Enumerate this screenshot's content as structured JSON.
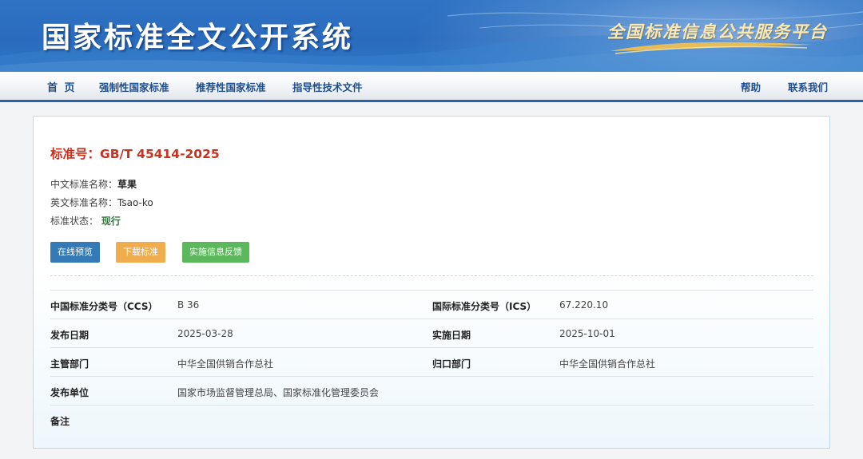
{
  "header": {
    "site_title": "国家标准全文公开系统",
    "slogan": "全国标准信息公共服务平台"
  },
  "nav": {
    "left": [
      "首 页",
      "强制性国家标准",
      "推荐性国家标准",
      "指导性技术文件"
    ],
    "right": [
      "帮助",
      "联系我们"
    ]
  },
  "standard": {
    "number": "标准号：GB/T 45414-2025",
    "cn_name_label": "中文标准名称：",
    "cn_name": "草果",
    "en_name_label": "英文标准名称：",
    "en_name": "Tsao-ko",
    "status_label": "标准状态：",
    "status": "现行"
  },
  "buttons": {
    "preview": "在线预览",
    "download": "下载标准",
    "feedback": "实施信息反馈"
  },
  "details": [
    {
      "label": "中国标准分类号（CCS）",
      "value": "B 36",
      "label2": "国际标准分类号（ICS）",
      "value2": "67.220.10"
    },
    {
      "label": "发布日期",
      "value": "2025-03-28",
      "label2": "实施日期",
      "value2": "2025-10-01"
    },
    {
      "label": "主管部门",
      "value": "中华全国供销合作总社",
      "label2": "归口部门",
      "value2": "中华全国供销合作总社"
    },
    {
      "label": "发布单位",
      "value": "国家市场监督管理总局、国家标准化管理委员会",
      "label2": "",
      "value2": ""
    },
    {
      "label": "备注",
      "value": "",
      "label2": "",
      "value2": ""
    }
  ],
  "colors": {
    "banner_blue": "#2f73c4",
    "nav_text": "#1f4e8c",
    "standard_number_red": "#c8321f",
    "status_green": "#2f7a3a",
    "btn_preview": "#337ab7",
    "btn_download": "#f0ad4e",
    "btn_feedback": "#5cb85c"
  }
}
